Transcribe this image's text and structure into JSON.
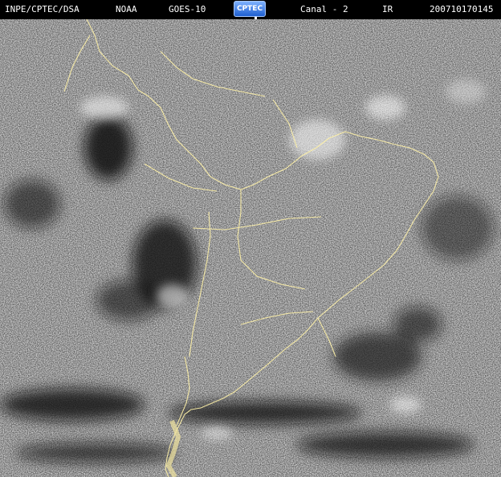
{
  "header": {
    "source": "INPE/CPTEC/DSA",
    "agency": "NOAA",
    "satellite": "GOES-10",
    "logo_text": "CPTEC",
    "channel": "Canal - 2",
    "band": "IR",
    "timestamp": "200710170145"
  },
  "colors": {
    "background": "#000000",
    "header_text": "#ffffff",
    "coastline": "#fff2a8",
    "logo": "#3b7be0"
  },
  "image": {
    "description_type": "satellite-infrared-image",
    "region": "south-america-map"
  }
}
